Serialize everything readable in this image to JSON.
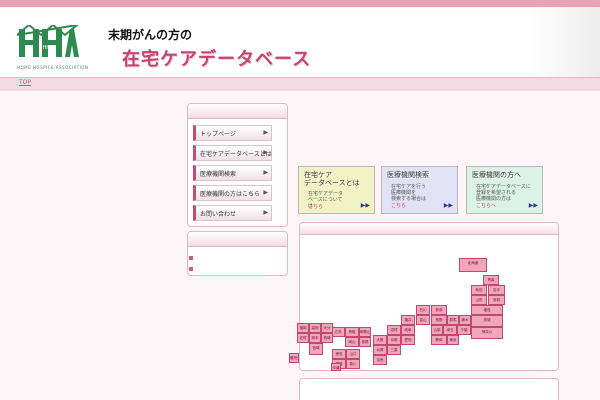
{
  "header": {
    "logo_text": "HHA",
    "logo_tagline": "HOME HOSPICE ASSOCIATION",
    "subtitle": "末期がんの方の",
    "title": "在宅ケアデータベース"
  },
  "breadcrumb": {
    "top": "TOP"
  },
  "sidebar": {
    "menu": [
      {
        "label": "トップページ"
      },
      {
        "label": "在宅ケアデータベースとは"
      },
      {
        "label": "医療機関検索"
      },
      {
        "label": "医療機関の方はこちら"
      },
      {
        "label": "お問い合わせ"
      }
    ],
    "arrow": "▶"
  },
  "cards": [
    {
      "title": "在宅ケア\nデータベースとは",
      "desc": "在宅ケアデータ\nベースについて\nは",
      "link": "こちら",
      "arrow": "▶▶",
      "bg": "#f2f2c4"
    },
    {
      "title": "医療機関検索",
      "desc": "在宅ケアを行う\n医療機関を\n検索する場合は",
      "link": "こちら",
      "arrow": "▶▶",
      "bg": "#e2e2f6"
    },
    {
      "title": "医療機関の方へ",
      "desc": "在宅ケアデータベースに\n登録を希望される\n医療機関の方は",
      "link": "こちらへ",
      "arrow": "▶▶",
      "bg": "#dbf2e6"
    }
  ],
  "map": {
    "prefectures": [
      "北海道",
      "青森",
      "秋田",
      "岩手",
      "山形",
      "宮城",
      "新潟",
      "福島",
      "富山",
      "石川",
      "長野",
      "群馬",
      "栃木",
      "茨城",
      "福井",
      "岐阜",
      "山梨",
      "埼玉",
      "千葉",
      "東京",
      "神奈川",
      "静岡",
      "愛知",
      "滋賀",
      "京都",
      "三重",
      "大阪",
      "兵庫",
      "奈良",
      "和歌山",
      "鳥取",
      "島根",
      "岡山",
      "広島",
      "山口",
      "香川",
      "徳島",
      "愛媛",
      "高知",
      "福岡",
      "佐賀",
      "長崎",
      "大分",
      "熊本",
      "宮崎",
      "鹿児島",
      "沖縄"
    ]
  }
}
